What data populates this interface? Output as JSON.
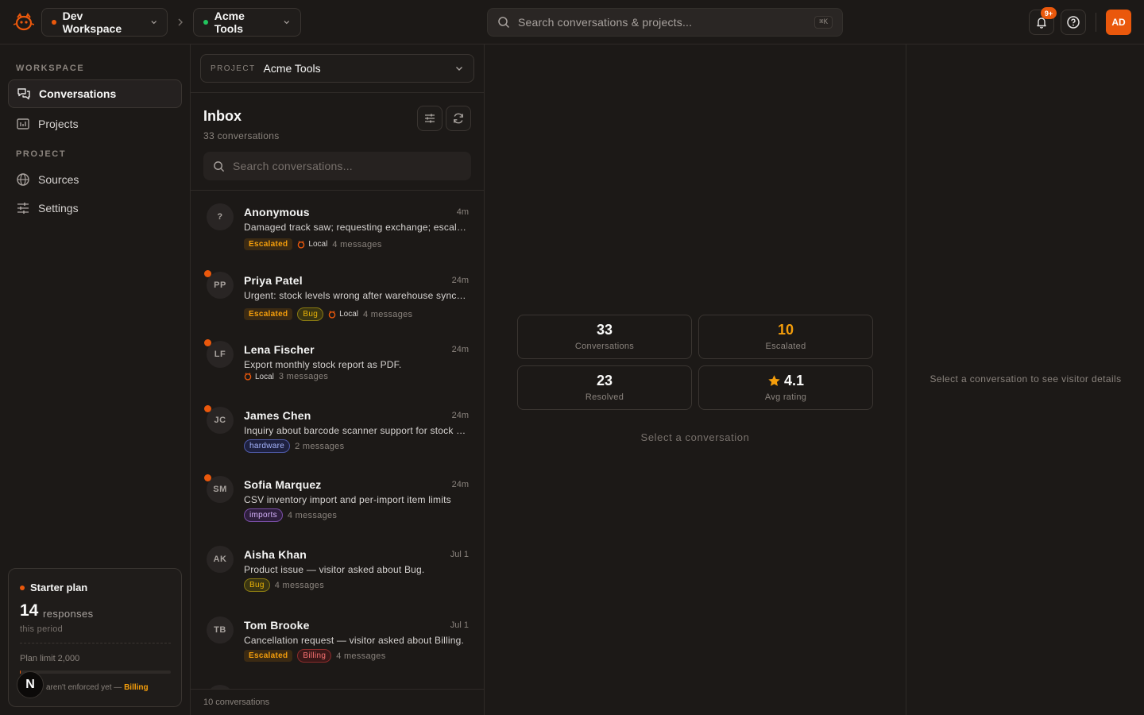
{
  "topbar": {
    "workspace": {
      "label": "Dev Workspace",
      "dot_color": "#ea580c"
    },
    "project": {
      "label": "Acme Tools",
      "dot_color": "#22c55e"
    },
    "search": {
      "placeholder": "Search conversations & projects...",
      "shortcut": "⌘K"
    },
    "notifications": {
      "badge": "9+",
      "icon": "bell-icon"
    },
    "help_icon": "help-circle-icon",
    "avatar_initials": "AD"
  },
  "sidebar": {
    "workspace_section": "WORKSPACE",
    "workspace_items": [
      {
        "label": "Conversations",
        "icon": "chat-icon",
        "active": true
      },
      {
        "label": "Projects",
        "icon": "projects-icon",
        "active": false
      }
    ],
    "project_section": "PROJECT",
    "project_items": [
      {
        "label": "Sources",
        "icon": "globe-icon"
      },
      {
        "label": "Settings",
        "icon": "sliders-icon"
      }
    ],
    "plan": {
      "name": "Starter plan",
      "responses": "14",
      "responses_unit": "responses",
      "period": "this period",
      "limit": "Plan limit 2,000",
      "usage_fraction": 0.007,
      "note": "aren't enforced yet —",
      "note_link": "Billing"
    },
    "user_initial": "N"
  },
  "inbox": {
    "project_label": "PROJECT",
    "project_value": "Acme Tools",
    "title": "Inbox",
    "count": "33 conversations",
    "search_placeholder": "Search conversations...",
    "footer": "10 conversations",
    "conversations": [
      {
        "initials": "?",
        "name": "Anonymous",
        "time": "4m",
        "unread": false,
        "preview": "Damaged track saw; requesting exchange; escalated to support",
        "escalated": true,
        "tags": [],
        "source": "Local",
        "messages": "4 messages"
      },
      {
        "initials": "PP",
        "name": "Priya Patel",
        "time": "24m",
        "unread": true,
        "preview": "Urgent: stock levels wrong after warehouse sync since this morning",
        "escalated": true,
        "tags": [
          {
            "label": "Bug",
            "kind": "bug"
          }
        ],
        "source": "Local",
        "messages": "4 messages"
      },
      {
        "initials": "LF",
        "name": "Lena Fischer",
        "time": "24m",
        "unread": true,
        "preview": "Export monthly stock report as PDF.",
        "escalated": false,
        "tags": [],
        "source": "Local",
        "messages": "3 messages"
      },
      {
        "initials": "JC",
        "name": "James Chen",
        "time": "24m",
        "unread": true,
        "preview": "Inquiry about barcode scanner support for stock counting",
        "escalated": false,
        "tags": [
          {
            "label": "hardware",
            "kind": "hardware"
          }
        ],
        "source": "",
        "messages": "2 messages"
      },
      {
        "initials": "SM",
        "name": "Sofia Marquez",
        "time": "24m",
        "unread": true,
        "preview": "CSV inventory import and per-import item limits",
        "escalated": false,
        "tags": [
          {
            "label": "imports",
            "kind": "imports"
          }
        ],
        "source": "",
        "messages": "4 messages"
      },
      {
        "initials": "AK",
        "name": "Aisha Khan",
        "time": "Jul 1",
        "unread": false,
        "preview": "Product issue — visitor asked about Bug.",
        "escalated": false,
        "tags": [
          {
            "label": "Bug",
            "kind": "bug"
          }
        ],
        "source": "",
        "messages": "4 messages"
      },
      {
        "initials": "TB",
        "name": "Tom Brooke",
        "time": "Jul 1",
        "unread": false,
        "preview": "Cancellation request — visitor asked about Billing.",
        "escalated": true,
        "tags": [
          {
            "label": "Billing",
            "kind": "billing"
          }
        ],
        "source": "",
        "messages": "4 messages"
      }
    ],
    "escalated_label": "Escalated"
  },
  "stats": {
    "conversations": {
      "value": "33",
      "label": "Conversations"
    },
    "escalated": {
      "value": "10",
      "label": "Escalated",
      "color": "#f59e0b"
    },
    "resolved": {
      "value": "23",
      "label": "Resolved"
    },
    "rating": {
      "value": "4.1",
      "label": "Avg rating",
      "icon": "star-icon"
    }
  },
  "main": {
    "empty_hint": "Select a conversation"
  },
  "details": {
    "empty_hint": "Select a conversation to see visitor details"
  }
}
